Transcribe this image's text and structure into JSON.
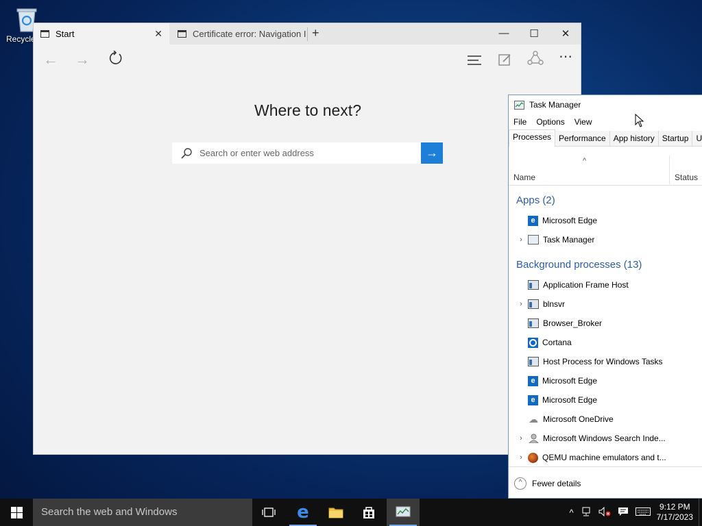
{
  "desktop": {
    "recycle_label": "Recycle"
  },
  "edge": {
    "tabs": [
      {
        "label": "Start"
      },
      {
        "label": "Certificate error: Navigation I"
      }
    ],
    "heading": "Where to next?",
    "search_placeholder": "Search or enter web address"
  },
  "task_manager": {
    "title": "Task Manager",
    "menu": [
      "File",
      "Options",
      "View"
    ],
    "tabs": [
      "Processes",
      "Performance",
      "App history",
      "Startup",
      "U"
    ],
    "columns": {
      "name": "Name",
      "status": "Status"
    },
    "apps_header": "Apps (2)",
    "apps": [
      {
        "name": "Microsoft Edge",
        "icon": "edge-icon",
        "expandable": false
      },
      {
        "name": "Task Manager",
        "icon": "task-manager-icon",
        "expandable": true
      }
    ],
    "bg_header": "Background processes (13)",
    "background": [
      {
        "name": "Application Frame Host",
        "icon": "window-frame-icon",
        "expandable": false
      },
      {
        "name": "blnsvr",
        "icon": "window-frame-icon",
        "expandable": true
      },
      {
        "name": "Browser_Broker",
        "icon": "window-frame-icon",
        "expandable": false
      },
      {
        "name": "Cortana",
        "icon": "cortana-icon",
        "expandable": false
      },
      {
        "name": "Host Process for Windows Tasks",
        "icon": "window-frame-icon",
        "expandable": false
      },
      {
        "name": "Microsoft Edge",
        "icon": "edge-icon",
        "expandable": false
      },
      {
        "name": "Microsoft Edge",
        "icon": "edge-icon",
        "expandable": false
      },
      {
        "name": "Microsoft OneDrive",
        "icon": "cloud-icon",
        "expandable": false
      },
      {
        "name": "Microsoft Windows Search Inde...",
        "icon": "user-icon",
        "expandable": true
      },
      {
        "name": "QEMU machine emulators and t...",
        "icon": "qemu-icon",
        "expandable": true
      }
    ],
    "fewer_details": "Fewer details"
  },
  "taskbar": {
    "search_text": "Search the web and Windows",
    "time": "9:12 PM",
    "date": "7/17/2023"
  }
}
